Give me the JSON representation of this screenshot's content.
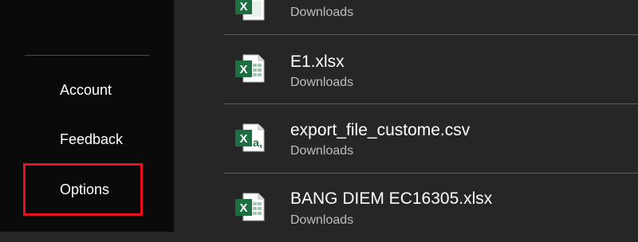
{
  "sidebar": {
    "items": [
      {
        "label": "Account"
      },
      {
        "label": "Feedback"
      },
      {
        "label": "Options"
      }
    ]
  },
  "files": [
    {
      "name": "",
      "location": "Downloads",
      "type": "excel"
    },
    {
      "name": "E1.xlsx",
      "location": "Downloads",
      "type": "excel"
    },
    {
      "name": "export_file_custome.csv",
      "location": "Downloads",
      "type": "csv"
    },
    {
      "name": "BANG DIEM EC16305.xlsx",
      "location": "Downloads",
      "type": "excel"
    }
  ],
  "colors": {
    "excel_green": "#1d6f42",
    "highlight": "#e81123"
  }
}
